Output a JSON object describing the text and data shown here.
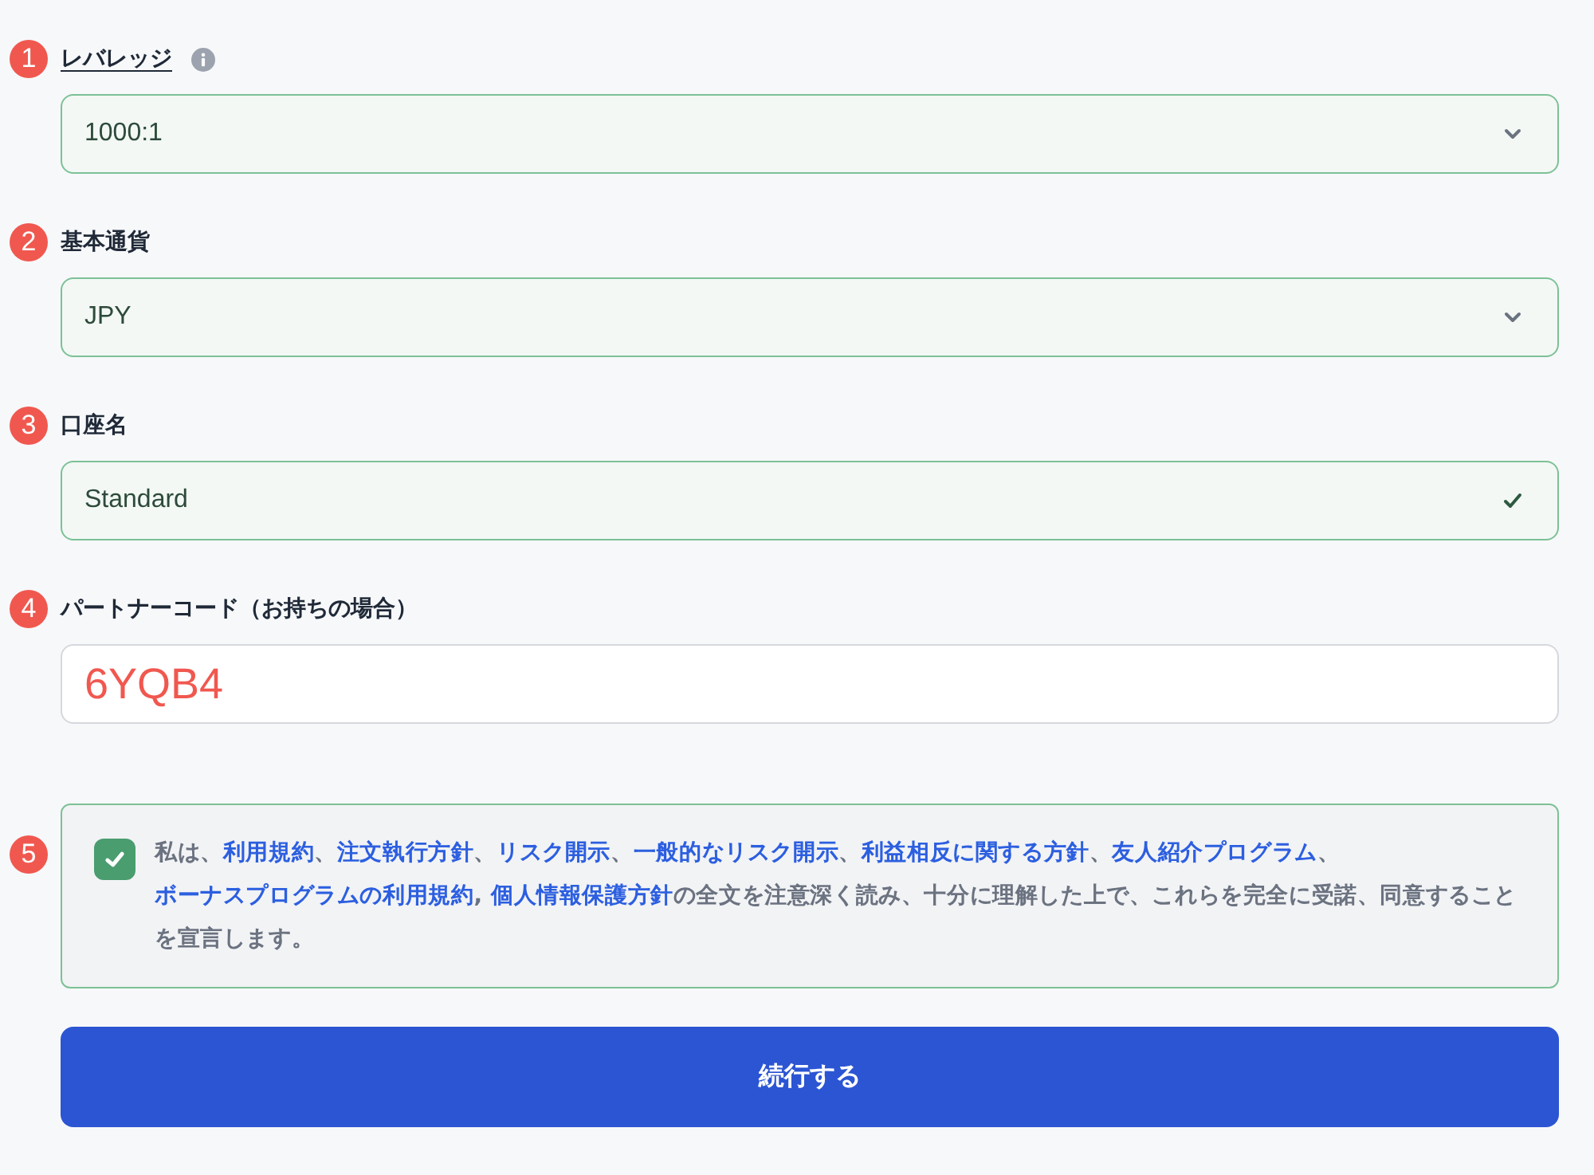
{
  "fields": [
    {
      "marker": "1",
      "label": "レバレッジ",
      "has_tooltip": true,
      "kind": "select",
      "value": "1000:1",
      "valid": true
    },
    {
      "marker": "2",
      "label": "基本通貨",
      "has_tooltip": false,
      "kind": "select",
      "value": "JPY",
      "valid": true
    },
    {
      "marker": "3",
      "label": "口座名",
      "has_tooltip": false,
      "kind": "text",
      "value": "Standard",
      "valid": true
    },
    {
      "marker": "4",
      "label": "パートナーコード（お持ちの場合）",
      "has_tooltip": false,
      "kind": "code",
      "value": "6YQB4",
      "valid": false
    }
  ],
  "agreement": {
    "marker": "5",
    "checked": true,
    "segments": [
      {
        "kind": "text",
        "text": "私は、"
      },
      {
        "kind": "link",
        "text": "利用規約"
      },
      {
        "kind": "text",
        "text": "、"
      },
      {
        "kind": "link",
        "text": "注文執行方針"
      },
      {
        "kind": "text",
        "text": "、"
      },
      {
        "kind": "link",
        "text": "リスク開示"
      },
      {
        "kind": "text",
        "text": "、"
      },
      {
        "kind": "link",
        "text": "一般的なリスク開示"
      },
      {
        "kind": "text",
        "text": "、"
      },
      {
        "kind": "link",
        "text": "利益相反に関する方針"
      },
      {
        "kind": "text",
        "text": "、"
      },
      {
        "kind": "link",
        "text": "友人紹介プログラム"
      },
      {
        "kind": "text",
        "text": "、"
      },
      {
        "kind": "link",
        "text": "ボーナスプログラムの利用規約"
      },
      {
        "kind": "text",
        "text": ", "
      },
      {
        "kind": "link",
        "text": "個人情報保護方針"
      },
      {
        "kind": "text",
        "text": "の全文を注意深く読み、十分に理解した上で、これらを完全に受諾、同意することを宣言します。"
      }
    ]
  },
  "submit": {
    "label": "続行する"
  }
}
